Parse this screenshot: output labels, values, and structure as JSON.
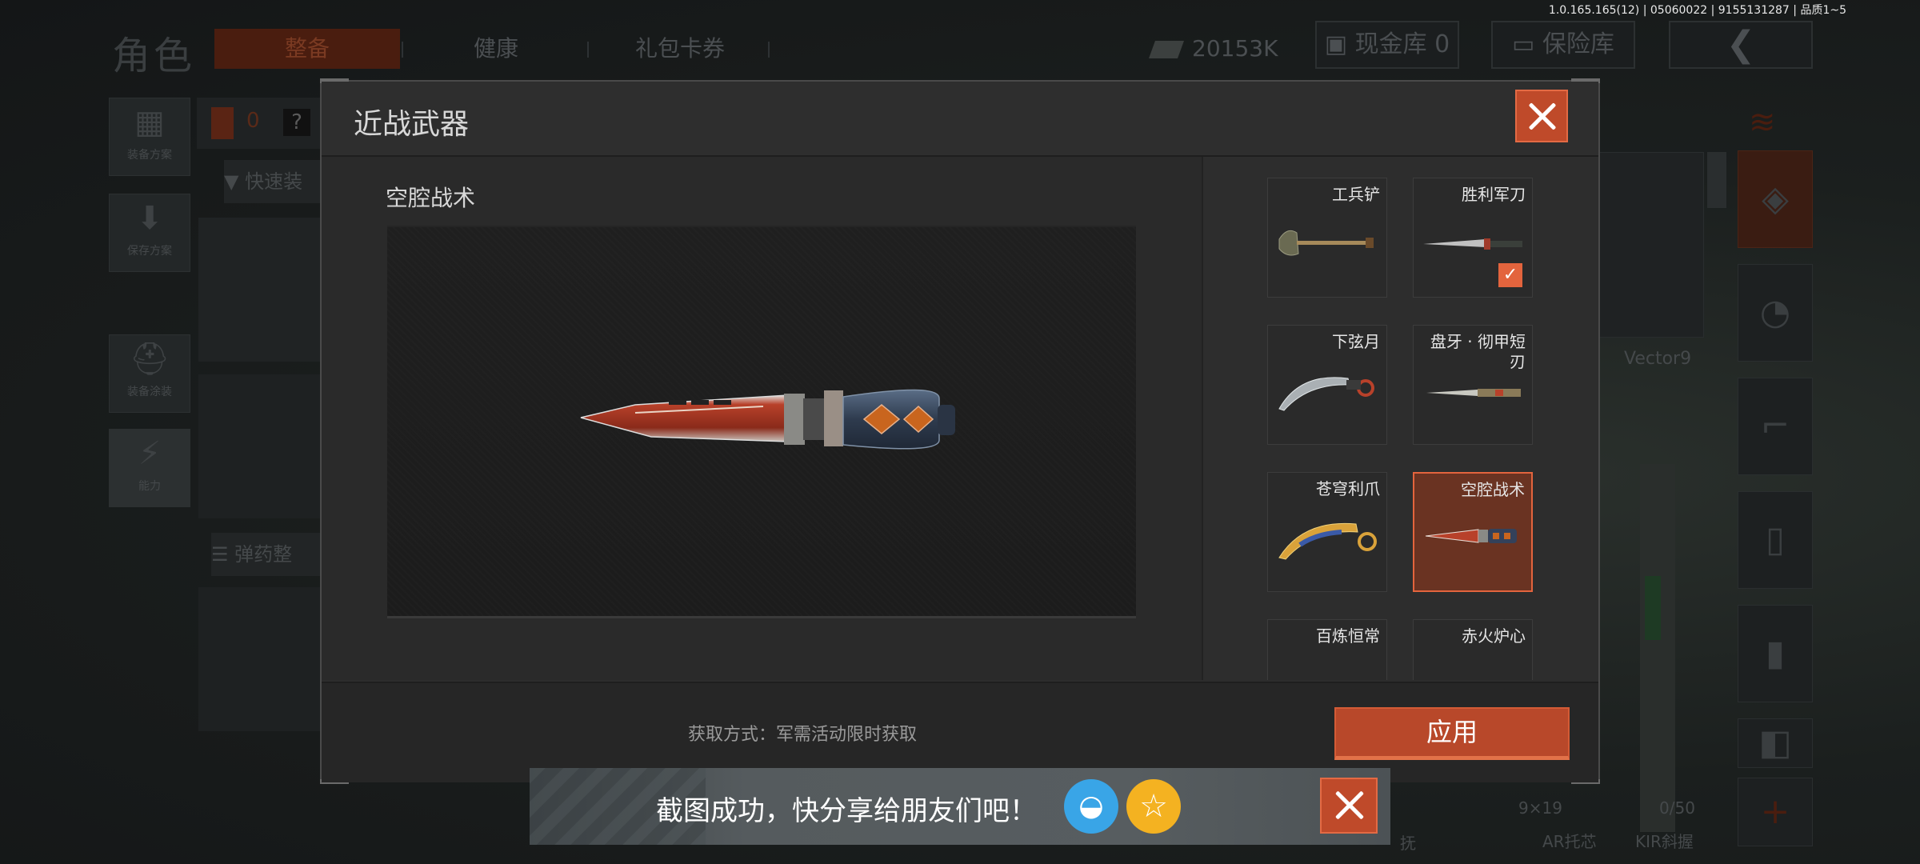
{
  "version": "1.0.165.165(12) | 05060022 | 9155131287 | 品质1~5",
  "background": {
    "page_title": "角色",
    "tabs": [
      "整备",
      "健康",
      "礼包卡券"
    ],
    "currency": "20153K",
    "cash_vault": "现金库 0",
    "insurance_vault": "保险库",
    "armor_count": "0",
    "unknown_badge": "?",
    "side_buttons": [
      "装备方案",
      "保存方案",
      "装备涂装",
      "能力"
    ],
    "quick_equip": "快速装",
    "ammo_sort": "弹药整",
    "weapon_label": "Vector9",
    "ammo_caliber": "9×19",
    "ammo_count": "0/50",
    "attachment_label": "AR托芯",
    "attachment_label2": "KIR斜握",
    "partial_text": "抚"
  },
  "modal": {
    "title": "近战武器",
    "selected_weapon": "空腔战术",
    "obtain_method": "获取方式：军需活动限时获取",
    "apply_label": "应用",
    "items": [
      {
        "name": "工兵铲",
        "equipped": false,
        "selected": false,
        "icon": "shovel-icon"
      },
      {
        "name": "胜利军刀",
        "equipped": true,
        "selected": false,
        "icon": "saber-icon"
      },
      {
        "name": "下弦月",
        "equipped": false,
        "selected": false,
        "icon": "karambit-icon"
      },
      {
        "name": "盘牙 · 彻甲短刃",
        "equipped": false,
        "selected": false,
        "icon": "dagger-icon"
      },
      {
        "name": "苍穹利爪",
        "equipped": false,
        "selected": false,
        "icon": "claw-icon"
      },
      {
        "name": "空腔战术",
        "equipped": false,
        "selected": true,
        "icon": "tactical-knife-icon"
      },
      {
        "name": "百炼恒常",
        "equipped": false,
        "selected": false,
        "icon": "blade-icon"
      },
      {
        "name": "赤火炉心",
        "equipped": false,
        "selected": false,
        "icon": "blade-icon"
      }
    ]
  },
  "toast": {
    "message": "截图成功，快分享给朋友们吧！",
    "qq_icon": "qq-icon",
    "favorite_icon": "star-icon"
  },
  "colors": {
    "accent": "#e3643d",
    "accent_dark": "#b8482a",
    "qq_blue": "#39a5e7",
    "star_yellow": "#f4b221"
  }
}
